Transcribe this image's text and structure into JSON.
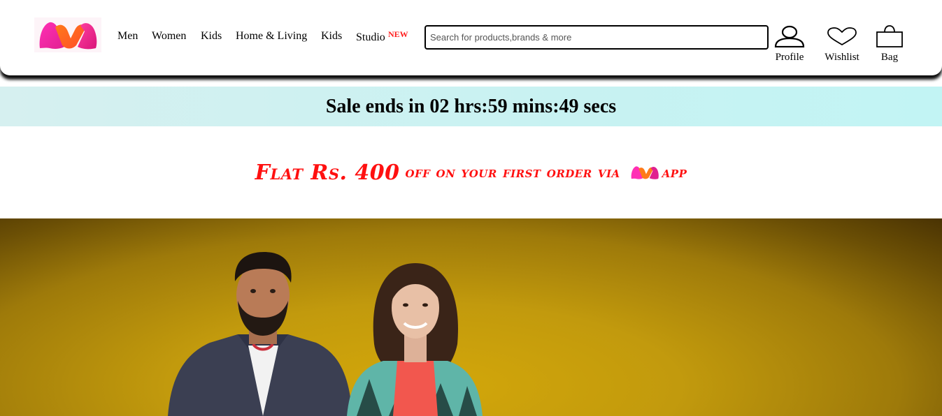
{
  "brand": {
    "logo_icon": "myntra-m-logo"
  },
  "nav": {
    "items": [
      {
        "label": "Men"
      },
      {
        "label": "Women"
      },
      {
        "label": "Kids"
      },
      {
        "label": "Home & Living"
      },
      {
        "label": "Kids"
      },
      {
        "label": "Studio"
      }
    ],
    "studio_badge": "NEW"
  },
  "search": {
    "placeholder": "Search for products,brands & more",
    "value": ""
  },
  "actions": {
    "profile": {
      "label": "Profile",
      "icon": "user-icon"
    },
    "wishlist": {
      "label": "Wishlist",
      "icon": "heart-icon"
    },
    "bag": {
      "label": "Bag",
      "icon": "bag-icon"
    }
  },
  "sale_banner": {
    "text": "Sale ends in 02 hrs:59 mins:49 secs"
  },
  "offer": {
    "main": "Flat Rs. 400",
    "rest": "off on your first order via",
    "suffix": "app",
    "color": "#ff1010"
  },
  "hero": {
    "image": "two-people-yellow-background"
  }
}
